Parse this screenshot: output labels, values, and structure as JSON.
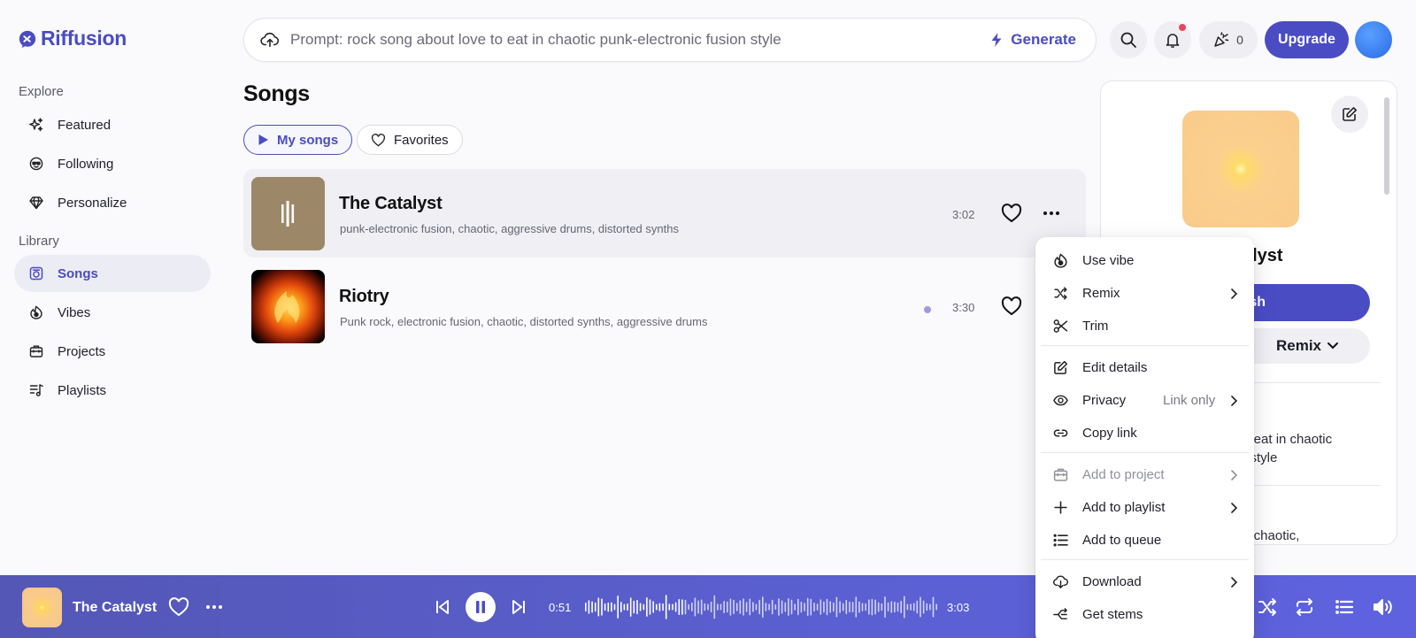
{
  "app": {
    "name": "Riffusion"
  },
  "sidebar": {
    "explore_label": "Explore",
    "library_label": "Library",
    "explore_items": [
      {
        "label": "Featured",
        "icon": "sparkles-icon"
      },
      {
        "label": "Following",
        "icon": "sunglasses-icon"
      },
      {
        "label": "Personalize",
        "icon": "gem-icon"
      }
    ],
    "library_items": [
      {
        "label": "Songs",
        "icon": "disc-icon",
        "active": true
      },
      {
        "label": "Vibes",
        "icon": "vibe-icon"
      },
      {
        "label": "Projects",
        "icon": "briefcase-icon"
      },
      {
        "label": "Playlists",
        "icon": "playlist-icon"
      }
    ]
  },
  "topbar": {
    "prompt_placeholder": "Prompt: rock song about love to eat in chaotic punk-electronic fusion style",
    "generate_label": "Generate",
    "credits": "0",
    "upgrade_label": "Upgrade"
  },
  "main": {
    "title": "Songs",
    "tabs": [
      {
        "label": "My songs",
        "active": true
      },
      {
        "label": "Favorites",
        "active": false
      }
    ],
    "songs": [
      {
        "title": "The Catalyst",
        "tags": "punk-electronic fusion, chaotic, aggressive drums, distorted synths",
        "duration": "3:02",
        "playing": true
      },
      {
        "title": "Riotry",
        "tags": "Punk rock, electronic fusion, chaotic, distorted synths, aggressive drums",
        "duration": "3:30",
        "new": true
      }
    ]
  },
  "detail": {
    "title_fragment": "alyst",
    "publish_fragment": "sh",
    "remix_label": "Remix",
    "prompt_fragment_1": "to eat in chaotic",
    "prompt_fragment_2": "n style",
    "tags_fragment": "n, chaotic,"
  },
  "menu": {
    "items": [
      {
        "label": "Use vibe",
        "icon": "vibe-icon"
      },
      {
        "label": "Remix",
        "icon": "shuffle-icon",
        "submenu": true
      },
      {
        "label": "Trim",
        "icon": "scissors-icon"
      },
      {
        "label": "Edit details",
        "icon": "edit-icon"
      },
      {
        "label": "Privacy",
        "icon": "eye-icon",
        "submenu": true,
        "value": "Link only"
      },
      {
        "label": "Copy link",
        "icon": "link-icon"
      },
      {
        "label": "Add to project",
        "icon": "briefcase-icon",
        "submenu": true,
        "disabled": true
      },
      {
        "label": "Add to playlist",
        "icon": "plus-icon",
        "submenu": true
      },
      {
        "label": "Add to queue",
        "icon": "list-icon"
      },
      {
        "label": "Download",
        "icon": "download-icon",
        "submenu": true
      },
      {
        "label": "Get stems",
        "icon": "stems-icon"
      }
    ]
  },
  "player": {
    "title": "The Catalyst",
    "current_time": "0:51",
    "total_time": "3:03",
    "progress": 0.28
  },
  "colors": {
    "accent": "#4a4cc4",
    "player_bg": "#5a5fd0",
    "notification": "#e5485b"
  }
}
